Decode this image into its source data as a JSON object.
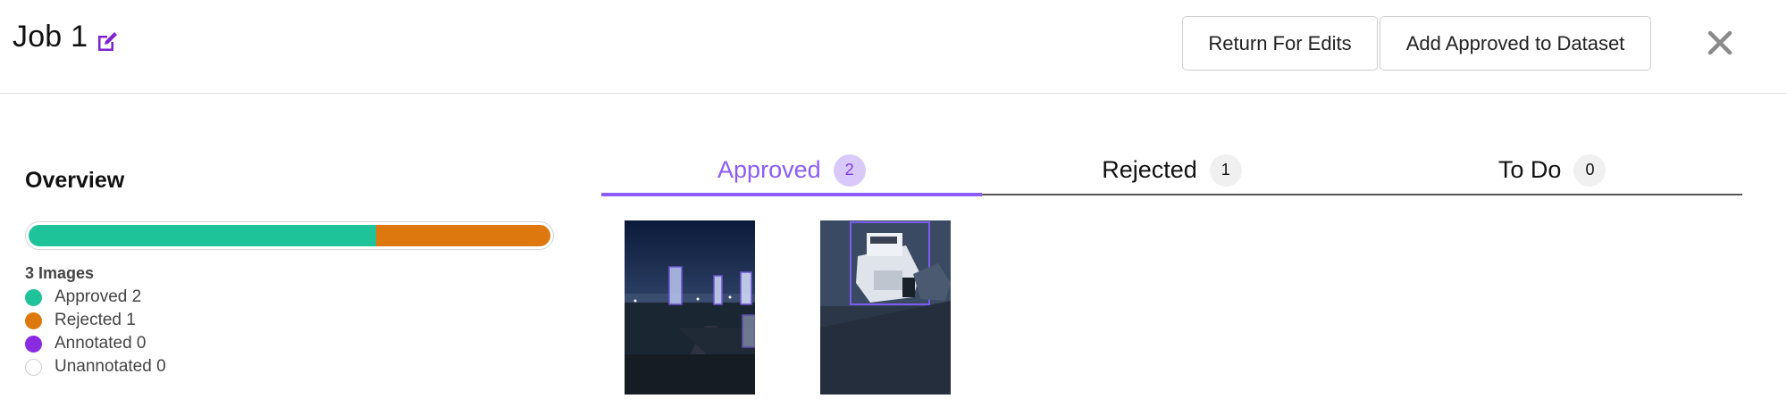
{
  "header": {
    "job_title": "Job 1",
    "return_button_label": "Return For Edits",
    "add_button_label": "Add Approved to Dataset",
    "edit_icon": "edit-icon",
    "close_icon": "close-icon"
  },
  "overview": {
    "title": "Overview",
    "images_count_label": "3 Images",
    "progress": {
      "approved_fraction": 0.6667,
      "rejected_fraction": 0.3333
    },
    "legend": [
      {
        "label": "Approved 2",
        "color": "#1fc39a"
      },
      {
        "label": "Rejected 1",
        "color": "#dd780e"
      },
      {
        "label": "Annotated 0",
        "color": "#8a2be2"
      },
      {
        "label": "Unannotated 0",
        "color": "#ffffff"
      }
    ]
  },
  "tabs": [
    {
      "label": "Approved",
      "count": "2",
      "active": true
    },
    {
      "label": "Rejected",
      "count": "1",
      "active": false
    },
    {
      "label": "To Do",
      "count": "0",
      "active": false
    }
  ],
  "thumbnails": [
    {
      "name": "harbor-night-thumbnail"
    },
    {
      "name": "boat-dock-thumbnail"
    }
  ],
  "colors": {
    "accent": "#8b5cf6",
    "approved": "#1fc39a",
    "rejected": "#dd780e",
    "annotated": "#8a2be2"
  }
}
